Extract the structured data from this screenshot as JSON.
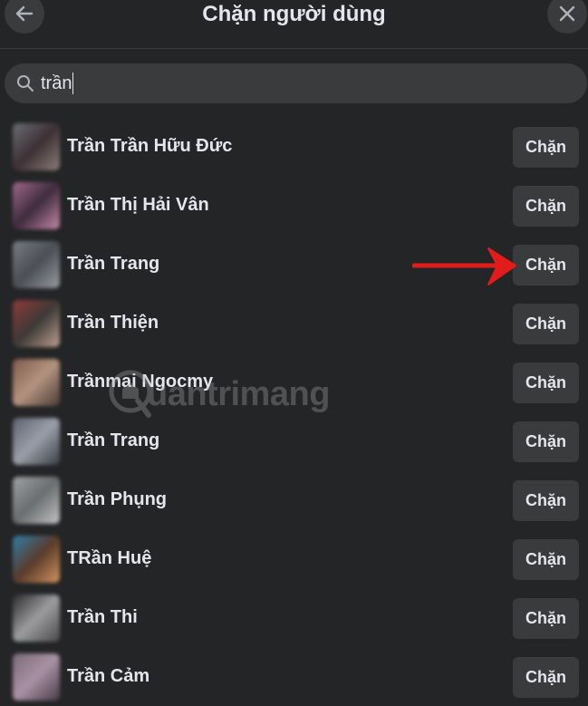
{
  "header": {
    "title": "Chặn người dùng",
    "back_icon": "arrow-left-icon",
    "close_icon": "close-icon"
  },
  "search": {
    "value": "trần",
    "icon": "search-icon"
  },
  "users": [
    {
      "name": "Trần Trần Hữu Đức",
      "action": "Chặn",
      "avatar_colors": [
        "#6b6f74",
        "#3d3034",
        "#8a7f7a"
      ]
    },
    {
      "name": "Trần Thị Hải Vân",
      "action": "Chặn",
      "avatar_colors": [
        "#a06b8d",
        "#3f2b3d",
        "#c58aa9"
      ]
    },
    {
      "name": "Trần Trang",
      "action": "Chặn",
      "avatar_colors": [
        "#7a7d83",
        "#4b4e55",
        "#9a9ca1"
      ]
    },
    {
      "name": "Trần Thiện",
      "action": "Chặn",
      "avatar_colors": [
        "#8f3b3a",
        "#3c3a36",
        "#c0a090"
      ]
    },
    {
      "name": "Trầnmai Ngocmy",
      "action": "Chặn",
      "avatar_colors": [
        "#7d5b4a",
        "#b49380",
        "#4a3c36"
      ]
    },
    {
      "name": "Trần Trang",
      "action": "Chặn",
      "avatar_colors": [
        "#5d6270",
        "#9a9ea8",
        "#3b3e46"
      ]
    },
    {
      "name": "Trần Phụng",
      "action": "Chặn",
      "avatar_colors": [
        "#9fa2a5",
        "#6b6e70",
        "#c3c4c5"
      ]
    },
    {
      "name": "TRần Huệ",
      "action": "Chặn",
      "avatar_colors": [
        "#2f7fa8",
        "#5a3b2b",
        "#d49560"
      ]
    },
    {
      "name": "Trần Thi",
      "action": "Chặn",
      "avatar_colors": [
        "#2b2b2d",
        "#9c9c9e",
        "#4a4a4c"
      ]
    },
    {
      "name": "Trần Cảm",
      "action": "Chặn",
      "avatar_colors": [
        "#7b6a78",
        "#a891a5",
        "#4a3c48"
      ]
    }
  ],
  "annotation": {
    "icon": "red-arrow-icon",
    "color": "#e21b1b"
  },
  "watermark": {
    "text": "uantrimang",
    "icon": "quantrimang-logo"
  },
  "colors": {
    "background": "#242526",
    "surface": "#3a3b3c",
    "text": "#e4e6eb"
  }
}
